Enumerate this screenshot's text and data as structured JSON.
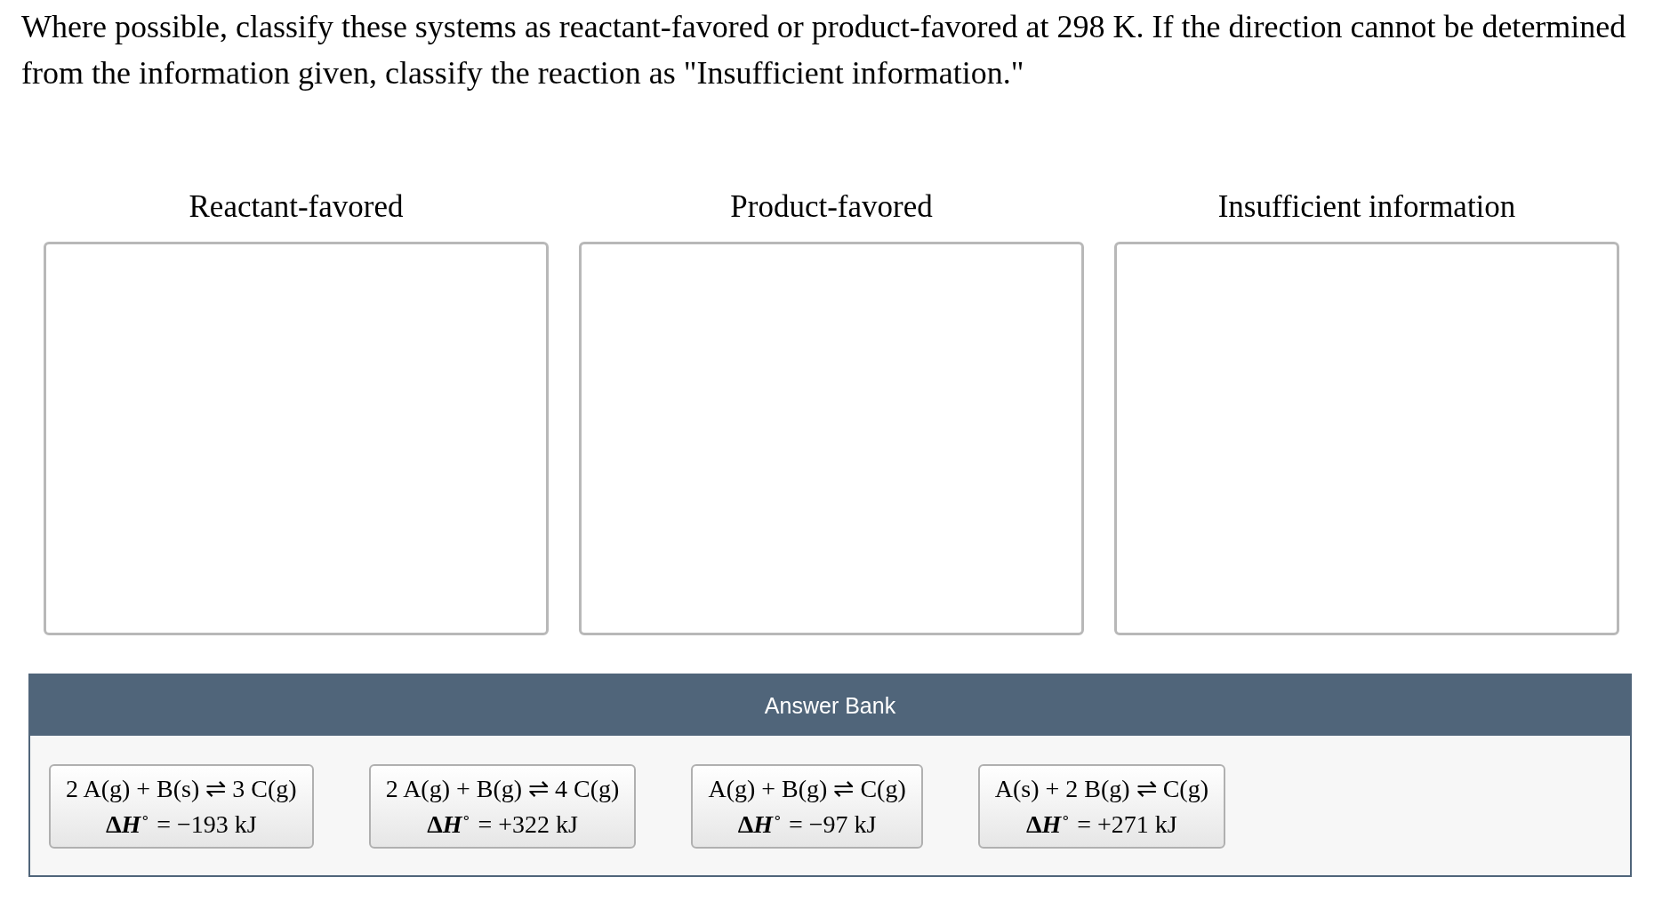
{
  "prompt": "Where possible, classify these systems as reactant-favored or product-favored at 298 K. If the direction cannot be determined from the information given, classify the reaction as \"Insufficient information.\"",
  "categories": [
    {
      "label": "Reactant-favored"
    },
    {
      "label": "Product-favored"
    },
    {
      "label": "Insufficient information"
    }
  ],
  "answer_bank": {
    "title": "Answer Bank",
    "items": [
      {
        "equation": "2 A(g) + B(s) ⇌ 3 C(g)",
        "enthalpy": {
          "delta": "Δ",
          "symbol": "H",
          "degree": "∘",
          "value": "= −193 kJ"
        }
      },
      {
        "equation": "2 A(g) + B(g) ⇌ 4 C(g)",
        "enthalpy": {
          "delta": "Δ",
          "symbol": "H",
          "degree": "∘",
          "value": "= +322 kJ"
        }
      },
      {
        "equation": "A(g) + B(g) ⇌ C(g)",
        "enthalpy": {
          "delta": "Δ",
          "symbol": "H",
          "degree": "∘",
          "value": "= −97 kJ"
        }
      },
      {
        "equation": "A(s) + 2 B(g) ⇌ C(g)",
        "enthalpy": {
          "delta": "Δ",
          "symbol": "H",
          "degree": "∘",
          "value": "= +271 kJ"
        }
      }
    ]
  }
}
